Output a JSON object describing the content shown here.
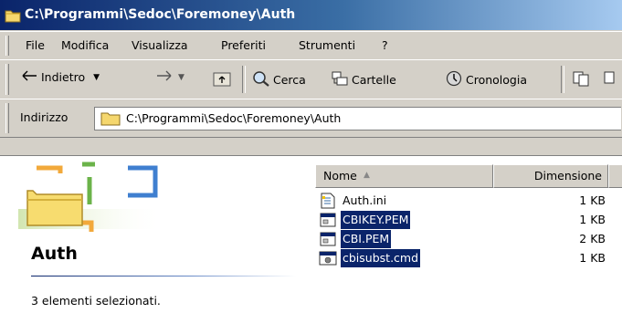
{
  "window": {
    "title": "C:\\Programmi\\Sedoc\\Foremoney\\Auth"
  },
  "menu": {
    "items": [
      "File",
      "Modifica",
      "Visualizza",
      "Preferiti",
      "Strumenti",
      "?"
    ]
  },
  "toolbar": {
    "back_label": "Indietro",
    "search_label": "Cerca",
    "folders_label": "Cartelle",
    "history_label": "Cronologia"
  },
  "address": {
    "label": "Indirizzo",
    "value": "C:\\Programmi\\Sedoc\\Foremoney\\Auth"
  },
  "left_pane": {
    "folder_name": "Auth",
    "status": "3 elementi selezionati."
  },
  "columns": {
    "name": "Nome",
    "size": "Dimensione"
  },
  "files": [
    {
      "name": "Auth.ini",
      "size": "1 KB",
      "icon": "ini-file-icon",
      "selected": false
    },
    {
      "name": "CBIKEY.PEM",
      "size": "1 KB",
      "icon": "generic-file-icon",
      "selected": true
    },
    {
      "name": "CBI.PEM",
      "size": "2 KB",
      "icon": "generic-file-icon",
      "selected": true
    },
    {
      "name": "cbisubst.cmd",
      "size": "1 KB",
      "icon": "cmd-file-icon",
      "selected": true
    }
  ],
  "colors": {
    "selection": "#0a246a",
    "titlebar_start": "#0a246a",
    "titlebar_end": "#a6caf0"
  }
}
